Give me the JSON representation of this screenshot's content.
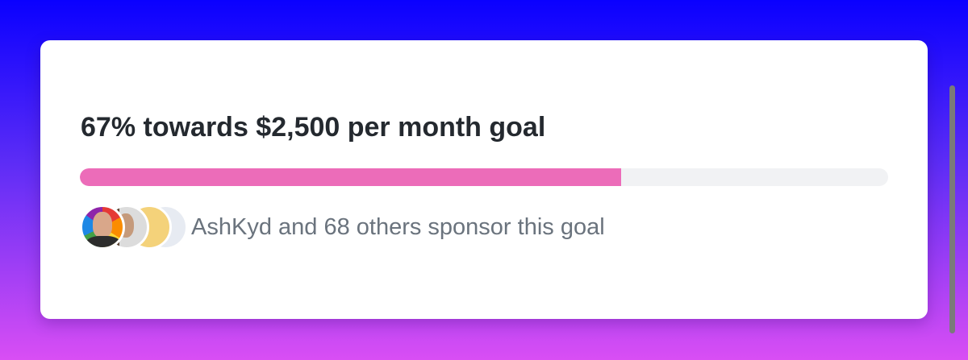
{
  "goal": {
    "title": "67% towards $2,500 per month goal",
    "progress": 0.67,
    "colors": {
      "fill": "#ec6cb9",
      "track": "#f1f2f4"
    }
  },
  "sponsors": {
    "text": "AshKyd and 68 others sponsor this goal",
    "avatars": [
      {
        "name": "AshKyd",
        "icon": "avatar-rainbow"
      },
      {
        "icon": "avatar-photo"
      },
      {
        "icon": "avatar-yellow"
      },
      {
        "icon": "avatar-light"
      }
    ]
  },
  "background": {
    "gradient_top": "#0a00ff",
    "gradient_bottom": "#d94ef4"
  }
}
